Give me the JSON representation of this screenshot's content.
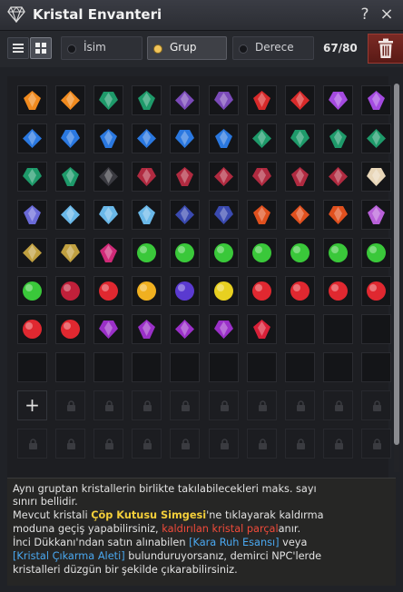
{
  "window": {
    "title": "Kristal Envanteri",
    "help_label": "?",
    "close_label": "×"
  },
  "toolbar": {
    "tabs": [
      {
        "label": "İsim",
        "active": false
      },
      {
        "label": "Grup",
        "active": true
      },
      {
        "label": "Derece",
        "active": false
      }
    ],
    "count": "67/80"
  },
  "grid": {
    "columns": 10,
    "rows": [
      [
        "orange",
        "orange",
        "green-dark",
        "green-dark",
        "purple",
        "purple",
        "red",
        "red",
        "violet",
        "violet"
      ],
      [
        "blue",
        "blue",
        "blue",
        "blue",
        "blue",
        "blue",
        "green-dark",
        "green-dark",
        "green-dark",
        "green-dark"
      ],
      [
        "green-dark",
        "green-dark",
        "dark",
        "crimson",
        "crimson",
        "crimson",
        "crimson",
        "crimson",
        "crimson",
        "pearl"
      ],
      [
        "prism",
        "ice",
        "ice",
        "ice",
        "navy",
        "navy",
        "orange-red",
        "orange-red",
        "orange-red",
        "violet-pink"
      ],
      [
        "gold-dark",
        "gold-dark",
        "magenta",
        "green",
        "green",
        "green",
        "green",
        "green",
        "green",
        "green"
      ],
      [
        "green",
        "ruby",
        "ruby-red",
        "gold",
        "indigo",
        "yellow",
        "ruby-red",
        "ruby-red",
        "ruby-red",
        "ruby-red"
      ],
      [
        "ruby-red",
        "ruby-red",
        "amethyst",
        "amethyst",
        "amethyst",
        "amethyst",
        "ruby-small",
        "empty",
        "empty",
        "empty"
      ],
      [
        "empty",
        "empty",
        "empty",
        "empty",
        "empty",
        "empty",
        "empty",
        "empty",
        "empty",
        "empty"
      ]
    ],
    "add_label": "+",
    "locked_rows": 2
  },
  "info": {
    "line1": "Aynı gruptan kristallerin birlikte takılabilecekleri maks. sayı",
    "line2": "sınırı bellidir.",
    "line3_a": "Mevcut kristali ",
    "line3_b": "Çöp Kutusu Simgesi",
    "line3_c": "'ne tıklayarak kaldırma",
    "line4_a": "moduna geçiş yapabilirsiniz, ",
    "line4_b": "kaldırılan kristal parçal",
    "line4_c": "anır.",
    "line5_a": "İnci Dükkanı'ndan satın alınabilen ",
    "line5_b": "[Kara Ruh Esansı]",
    "line5_c": " veya",
    "line6_a": "[Kristal Çıkarma Aleti]",
    "line6_b": " bulunduruyorsanız, demirci NPC'lerde",
    "line7": "kristalleri düzgün bir şekilde çıkarabilirsiniz."
  },
  "colors": {
    "orange": "#f08a1e",
    "green-dark": "#1e9a6a",
    "purple": "#7a4ab8",
    "red": "#d82a2a",
    "violet": "#a44ae0",
    "blue": "#2a78e0",
    "dark": "#3a3a40",
    "crimson": "#b02a40",
    "pearl": "#e8d6b8",
    "prism": "#6a6ad8",
    "ice": "#6ab8e8",
    "navy": "#3a4ab0",
    "orange-red": "#e0501e",
    "violet-pink": "#b860d8",
    "gold-dark": "#c0a040",
    "magenta": "#d02a78",
    "green": "#3ac83a",
    "ruby": "#c0203a",
    "ruby-red": "#e02830",
    "gold": "#f0b020",
    "indigo": "#5a3ad0",
    "yellow": "#e8d020",
    "amethyst": "#9a30c8",
    "ruby-small": "#d82038"
  }
}
